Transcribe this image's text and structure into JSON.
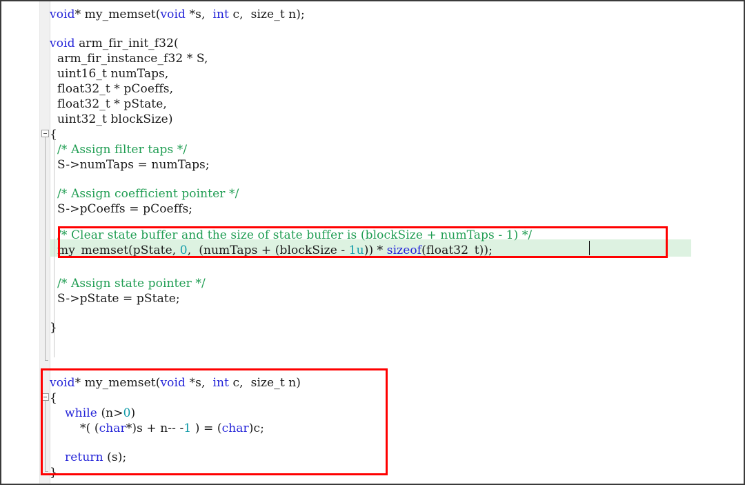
{
  "window": {
    "kind": "code-editor-screenshot",
    "language": "C"
  },
  "theme": {
    "background": "#ffffff",
    "gutter": "#f0f0f0",
    "text": "#1a1a1a",
    "keyword": "#2424d8",
    "comment": "#1f9d52",
    "number": "#0f9aa8",
    "highlight_band": "#ddf2e1",
    "annotation_box": "#ff0000",
    "border": "#3a3a3a"
  },
  "code": {
    "declaration": {
      "l1_a": "void",
      "l1_b": "* my_memset(",
      "l1_c": "void",
      "l1_d": " *s,  ",
      "l1_e": "int",
      "l1_f": " c,  size_t n);"
    },
    "function_signature": {
      "l3_kw": "void",
      "l3_rest": " arm_fir_init_f32(",
      "l4": "  arm_fir_instance_f32 * S,",
      "l5": "  uint16_t numTaps,",
      "l6": "  float32_t * pCoeffs,",
      "l7": "  float32_t * pState,",
      "l8": "  uint32_t blockSize)",
      "l9": "{"
    },
    "body": {
      "c1": "  /* Assign filter taps */",
      "s1": "  S->numTaps = numTaps;",
      "c2": "  /* Assign coefficient pointer */",
      "s2": "  S->pCoeffs = pCoeffs;",
      "c3": "  /* Clear state buffer and the size of state buffer is (blockSize + numTaps - 1) */",
      "memset_a": "  my_memset(pState, ",
      "memset_b": "0",
      "memset_c": ",  (numTaps + (blockSize - ",
      "memset_d": "1u",
      "memset_e": ")) * ",
      "memset_f": "sizeof",
      "memset_g": "(float32_t));",
      "c4": "  /* Assign state pointer */",
      "s3": "  S->pState = pState;",
      "close": "}"
    },
    "memset_impl": {
      "sig_a": "void",
      "sig_b": "* my_memset(",
      "sig_c": "void",
      "sig_d": " *s,  ",
      "sig_e": "int",
      "sig_f": " c,  size_t n)",
      "open": "{",
      "while_kw": "while",
      "while_cond_a": " (n>",
      "while_cond_b": "0",
      "while_cond_c": ")",
      "assign_a": "    *( (",
      "assign_b": "char",
      "assign_c": "*)s + n-- -",
      "assign_d": "1",
      "assign_e": " ) = (",
      "assign_f": "char",
      "assign_g": ")c;",
      "return_kw": "return",
      "return_rest": " (s);",
      "close": "}"
    }
  },
  "annotations": {
    "box_1_label": "highlighted-memset-call",
    "box_2_label": "highlighted-my-memset-implementation"
  }
}
